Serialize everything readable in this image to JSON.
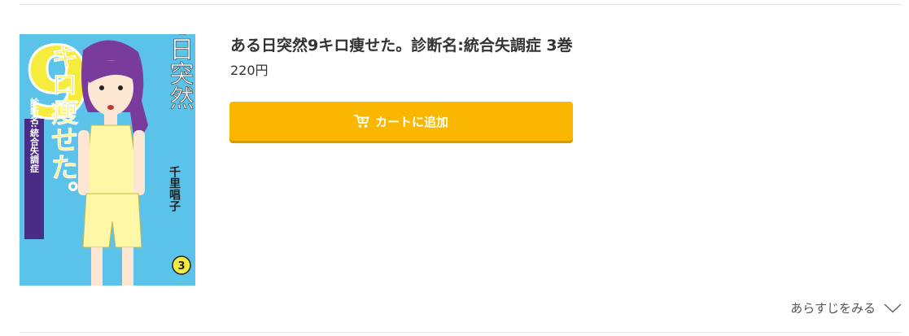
{
  "product": {
    "title": "ある日突然9キロ痩せた。診断名:統合失調症 3巻",
    "price": "220円"
  },
  "cover": {
    "background_color": "#5bc2e9",
    "accent_color": "#f6ec3e",
    "vertical_title": "ある日突然9キロ痩せた。",
    "subtitle_band": "診断名:統合失調症",
    "author": "千里唱子",
    "volume": "3"
  },
  "cart": {
    "label": "カートに追加",
    "icon": "cart-icon",
    "color": "#fbb700"
  },
  "synopsis": {
    "label": "あらすじをみる",
    "icon": "chevron-down-icon"
  }
}
